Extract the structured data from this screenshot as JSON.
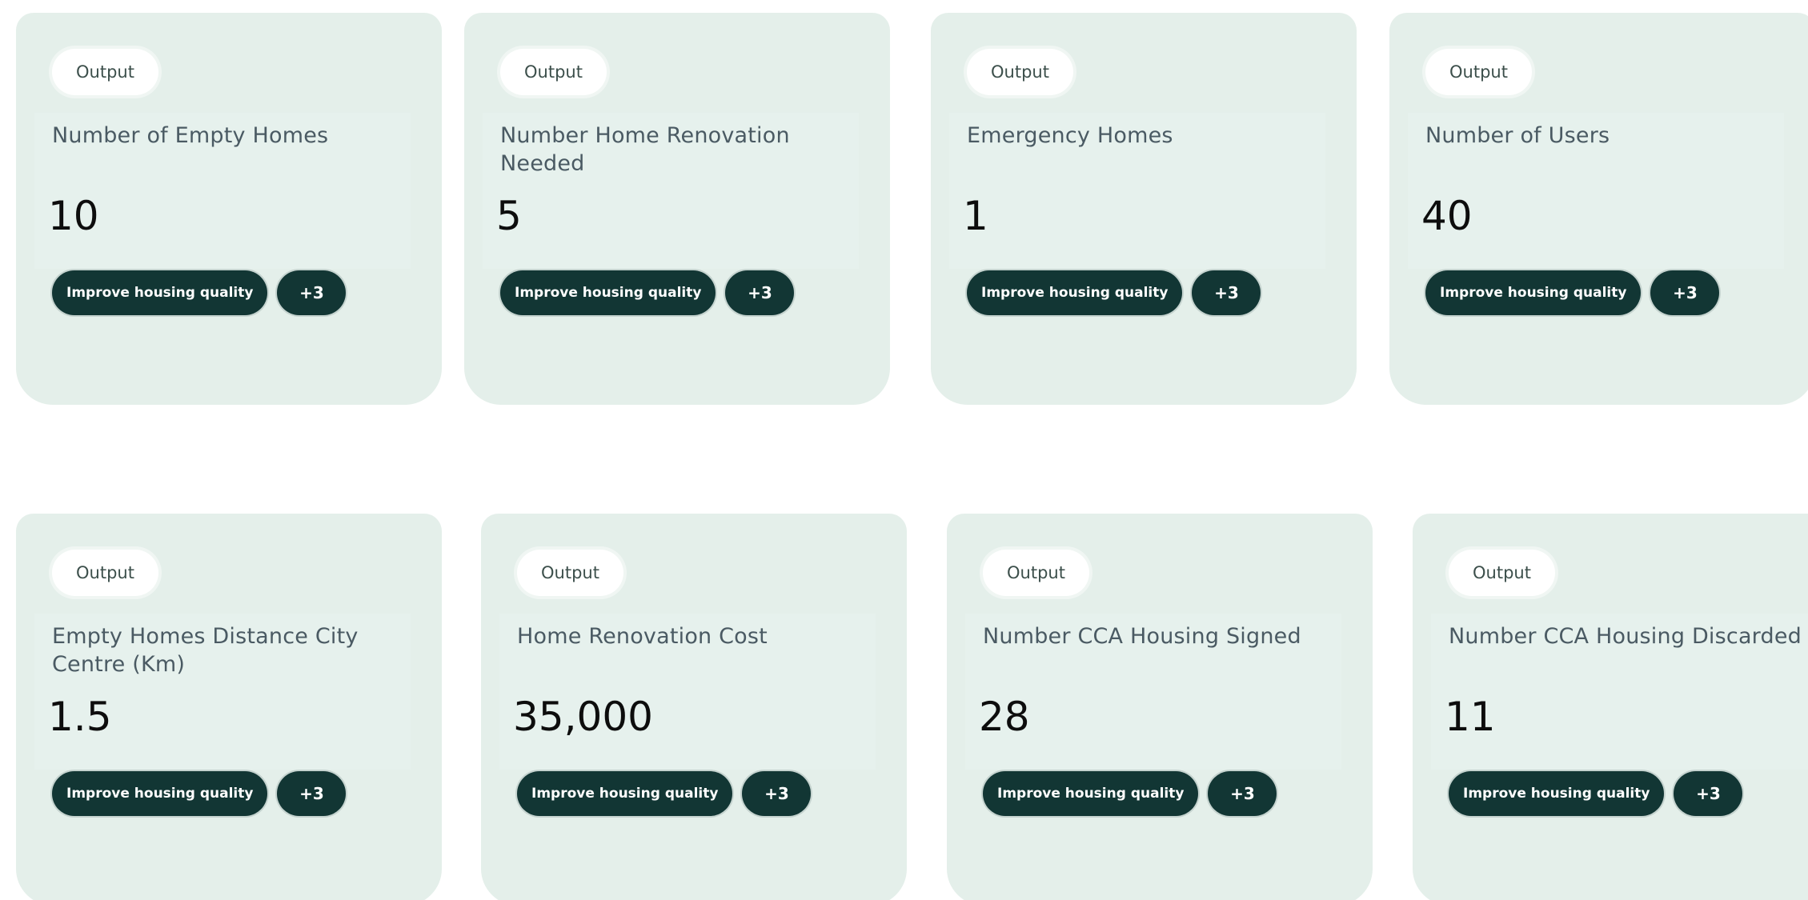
{
  "cards": [
    {
      "badge": "Output",
      "title": "Number of Empty Homes",
      "value": "10",
      "tag": "Improve housing quality",
      "more": "+3"
    },
    {
      "badge": "Output",
      "title": "Number Home Renovation Needed",
      "value": "5",
      "tag": "Improve housing quality",
      "more": "+3"
    },
    {
      "badge": "Output",
      "title": "Emergency Homes",
      "value": "1",
      "tag": "Improve housing quality",
      "more": "+3"
    },
    {
      "badge": "Output",
      "title": "Number of Users",
      "value": "40",
      "tag": "Improve housing quality",
      "more": "+3"
    },
    {
      "badge": "Output",
      "title": "Empty Homes Distance City Centre (Km)",
      "value": "1.5",
      "tag": "Improve housing quality",
      "more": "+3"
    },
    {
      "badge": "Output",
      "title": "Home Renovation Cost",
      "value": "35,000",
      "tag": "Improve housing quality",
      "more": "+3"
    },
    {
      "badge": "Output",
      "title": "Number CCA Housing Signed",
      "value": "28",
      "tag": "Improve housing quality",
      "more": "+3"
    },
    {
      "badge": "Output",
      "title": "Number CCA Housing Discarded",
      "value": "11",
      "tag": "Improve housing quality",
      "more": "+3"
    }
  ],
  "colors": {
    "card_bg": "#e4efea",
    "tag_bg": "#123634",
    "title_text": "#4a5a63"
  }
}
